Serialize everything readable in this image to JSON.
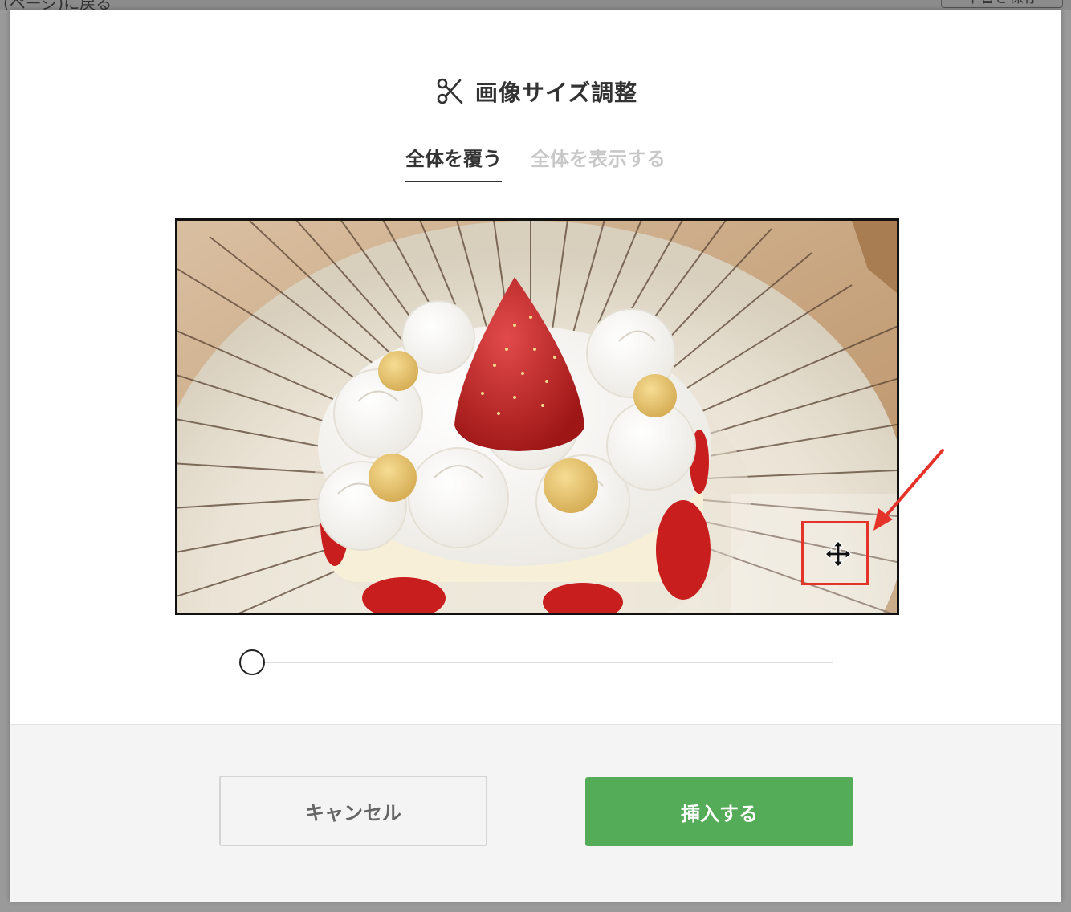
{
  "background": {
    "left_text": "(ページ)に戻る",
    "right_button": "下書き保存"
  },
  "dialog": {
    "title": "画像サイズ調整",
    "title_icon": "scissors-icon",
    "tabs": [
      {
        "label": "全体を覆う",
        "active": true
      },
      {
        "label": "全体を表示する",
        "active": false
      }
    ],
    "image_alt": "strawberry shortcake on a striped plate",
    "move_icon": "move-icon",
    "zoom_slider_value": 0,
    "buttons": {
      "cancel": "キャンセル",
      "insert": "挿入する"
    }
  },
  "colors": {
    "insert_button": "#54ab58",
    "annotation": "#e5332a",
    "inactive_tab": "#c8c8c8"
  }
}
